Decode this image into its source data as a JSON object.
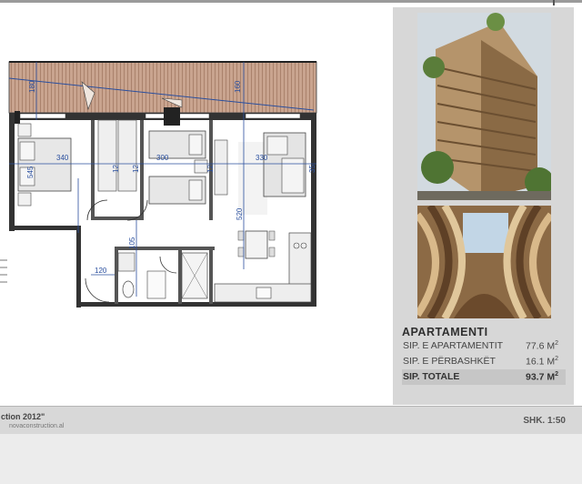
{
  "plan": {
    "dimensions": [
      "180",
      "160",
      "340",
      "300",
      "330",
      "545",
      "12",
      "12",
      "12",
      "35",
      "520",
      "105",
      "120"
    ]
  },
  "info": {
    "title": "APARTAMENTI",
    "rows": [
      {
        "label": "SIP. E APARTAMENTIT",
        "value": "77.6",
        "unit": "M",
        "exp": "2"
      },
      {
        "label": "SIP. E PËRBASHKËT",
        "value": "16.1",
        "unit": "M",
        "exp": "2"
      },
      {
        "label": "SIP. TOTALE",
        "value": "93.7",
        "unit": "M",
        "exp": "2"
      }
    ]
  },
  "footer": {
    "line1": "ction 2012\"",
    "line2": "novaconstruction.al",
    "scale": "SHK. 1:50"
  }
}
